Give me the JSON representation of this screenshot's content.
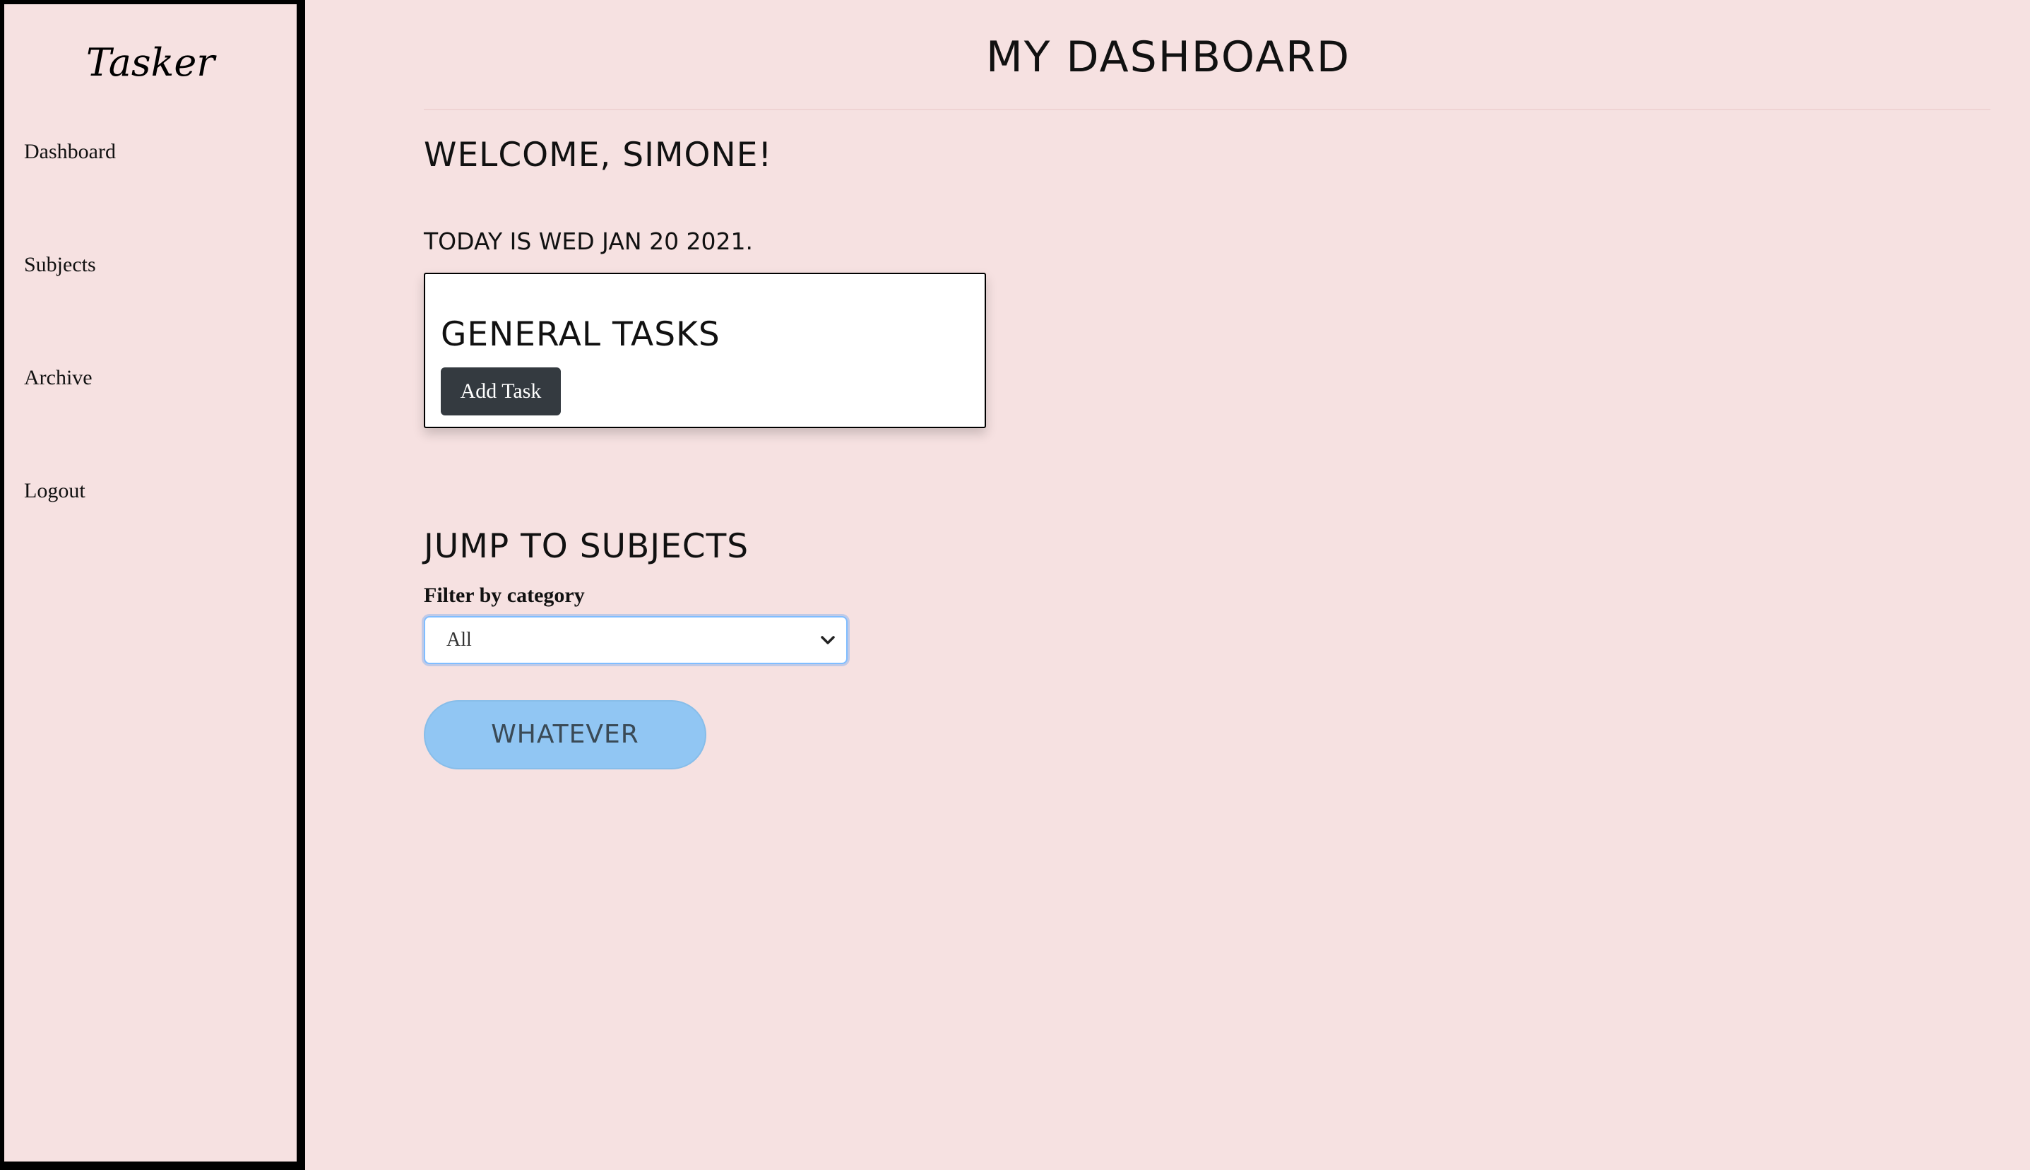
{
  "sidebar": {
    "brand": "Tasker",
    "items": [
      {
        "label": "Dashboard"
      },
      {
        "label": "Subjects"
      },
      {
        "label": "Archive"
      },
      {
        "label": "Logout"
      }
    ]
  },
  "header": {
    "title": "MY DASHBOARD"
  },
  "main": {
    "welcome": "WELCOME, SIMONE!",
    "today": "TODAY IS WED JAN 20 2021.",
    "general_tasks": {
      "title": "GENERAL TASKS",
      "add_button": "Add Task"
    },
    "jump": {
      "title": "JUMP TO SUBJECTS",
      "filter_label": "Filter by category",
      "selected": "All",
      "button": "WHATEVER"
    }
  },
  "icons": {
    "select": "chevron-down-icon"
  },
  "colors": {
    "background": "#f6e1e1",
    "dark_button": "#343a40",
    "pill_button": "#91c6f3",
    "focus_border": "#80bdff"
  }
}
